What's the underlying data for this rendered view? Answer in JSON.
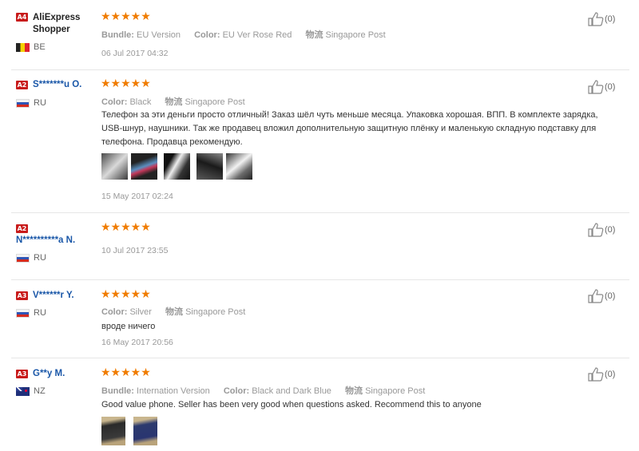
{
  "colors": {
    "stars": "#f07c00",
    "badge": "#c81b1b",
    "username_blue": "#1a57a8",
    "meta_gray": "#999999"
  },
  "reviews": [
    {
      "badge": "A4",
      "name": "AliExpress Shopper",
      "country": "BE",
      "flag": "belgium-flag-icon",
      "rating": 5,
      "stars": "★★★★★",
      "meta": [
        {
          "key": "Bundle:",
          "value": "EU Version"
        },
        {
          "key": "Color:",
          "value": "EU Ver Rose Red"
        },
        {
          "key": "物流",
          "value": "Singapore Post"
        }
      ],
      "text": "",
      "date": "06 Jul 2017 04:32",
      "likes": "(0)"
    },
    {
      "badge": "A2",
      "name": "S*******u O.",
      "country": "RU",
      "flag": "russia-flag-icon",
      "rating": 5,
      "stars": "★★★★★",
      "meta": [
        {
          "key": "Color:",
          "value": "Black"
        },
        {
          "key": "物流",
          "value": "Singapore Post"
        }
      ],
      "text": "Телефон за эти деньги просто отличный! Заказ шёл чуть меньше месяца. Упаковка хорошая. ВПП. В комплекте зарядка, USB-шнур, наушники. Так же продавец вложил дополнительную защитную плёнку и маленькую складную подставку для телефона. Продавца рекомендую.",
      "photos": 5,
      "date": "15 May 2017 02:24",
      "likes": "(0)"
    },
    {
      "badge": "A2",
      "name": "N**********a N.",
      "country": "RU",
      "flag": "russia-flag-icon",
      "rating": 5,
      "stars": "★★★★★",
      "meta": [],
      "text": "",
      "date": "10 Jul 2017 23:55",
      "likes": "(0)"
    },
    {
      "badge": "A3",
      "name": "V******r Y.",
      "country": "RU",
      "flag": "russia-flag-icon",
      "rating": 5,
      "stars": "★★★★★",
      "meta": [
        {
          "key": "Color:",
          "value": "Silver"
        },
        {
          "key": "物流",
          "value": "Singapore Post"
        }
      ],
      "text": "вроде ничего",
      "date": "16 May 2017 20:56",
      "likes": "(0)"
    },
    {
      "badge": "A3",
      "name": "G**y M.",
      "country": "NZ",
      "flag": "new-zealand-flag-icon",
      "rating": 5,
      "stars": "★★★★★",
      "meta": [
        {
          "key": "Bundle:",
          "value": "Internation Version"
        },
        {
          "key": "Color:",
          "value": "Black and Dark Blue"
        },
        {
          "key": "物流",
          "value": "Singapore Post"
        }
      ],
      "text": "Good value phone. Seller has been very good when questions asked. Recommend this to anyone",
      "photos": 2,
      "date": "",
      "likes": "(0)"
    }
  ]
}
